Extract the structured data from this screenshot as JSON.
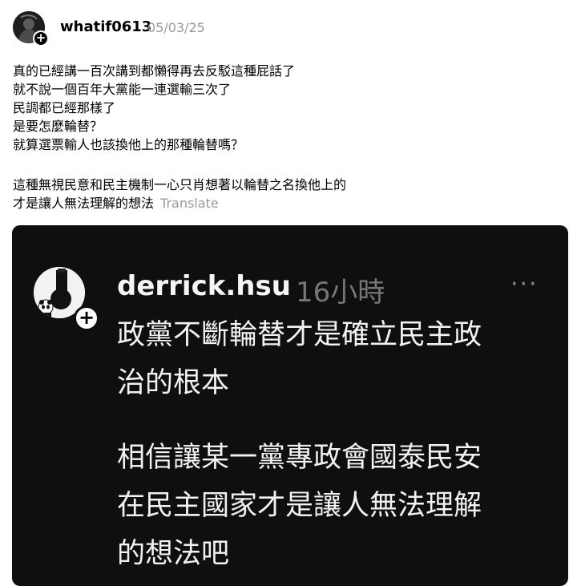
{
  "post": {
    "username": "whatif0613",
    "date": "05/03/25",
    "paragraph1": [
      "真的已經講一百次講到都懶得再去反駁這種屁話了",
      "就不說一個百年大黨能一連選輸三次了",
      "民調都已經那樣了",
      "是要怎麼輪替？",
      "就算選票輸人也該換他上的那種輪替嗎？"
    ],
    "paragraph2": [
      "這種無視民意和民主機制一心只肖想著以輪替之名換他上的",
      "才是讓人無法理解的想法"
    ],
    "translate_label": "Translate"
  },
  "embed": {
    "username": "derrick.hsu",
    "time": "16小時",
    "more": "···",
    "paragraph1": [
      "政黨不斷輪替才是確立民主政",
      "治的根本"
    ],
    "paragraph2": [
      "相信讓某一黨專政會國泰民安",
      "在民主國家才是讓人無法理解",
      "的想法吧"
    ]
  },
  "icons": {
    "follow": "plus-icon",
    "more": "more-horizontal-icon"
  }
}
